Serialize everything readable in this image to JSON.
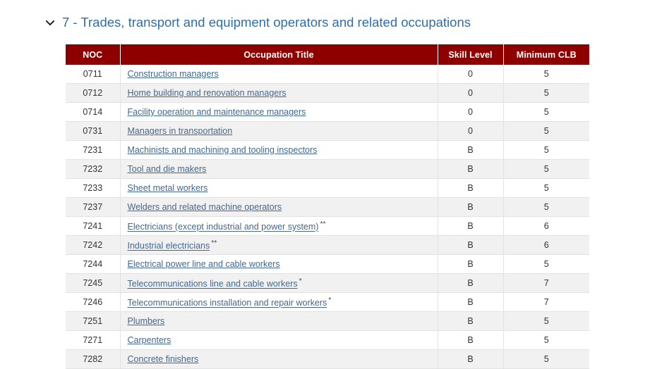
{
  "section": {
    "icon": "chevron-down-icon",
    "expanded": true,
    "title": "7 - Trades, transport and equipment operators and related occupations",
    "title_color": "#2f6ea8"
  },
  "table": {
    "header_bg": "#8e0000",
    "header_text_color": "#ffffff",
    "link_color": "#42688f",
    "row_alt_bg": "#f1f1f1",
    "columns": [
      "NOC",
      "Occupation Title",
      "Skill Level",
      "Minimum CLB"
    ],
    "rows": [
      {
        "noc": "0711",
        "title": "Construction managers",
        "note": "",
        "skill": "0",
        "clb": "5"
      },
      {
        "noc": "0712",
        "title": "Home building and renovation managers",
        "note": "",
        "skill": "0",
        "clb": "5"
      },
      {
        "noc": "0714",
        "title": "Facility operation and maintenance managers",
        "note": "",
        "skill": "0",
        "clb": "5"
      },
      {
        "noc": "0731",
        "title": "Managers in transportation",
        "note": "",
        "skill": "0",
        "clb": "5"
      },
      {
        "noc": "7231",
        "title": "Machinists and machining and tooling inspectors",
        "note": "",
        "skill": "B",
        "clb": "5"
      },
      {
        "noc": "7232",
        "title": "Tool and die makers",
        "note": "",
        "skill": "B",
        "clb": "5"
      },
      {
        "noc": "7233",
        "title": "Sheet metal workers",
        "note": "",
        "skill": "B",
        "clb": "5"
      },
      {
        "noc": "7237",
        "title": "Welders and related machine operators",
        "note": "",
        "skill": "B",
        "clb": "5"
      },
      {
        "noc": "7241",
        "title": "Electricians (except industrial and power system)",
        "note": "**",
        "skill": "B",
        "clb": "6"
      },
      {
        "noc": "7242",
        "title": "Industrial electricians",
        "note": "**",
        "skill": "B",
        "clb": "6"
      },
      {
        "noc": "7244",
        "title": "Electrical power line and cable workers",
        "note": "",
        "skill": "B",
        "clb": "5"
      },
      {
        "noc": "7245",
        "title": "Telecommunications line and cable workers",
        "note": "*",
        "skill": "B",
        "clb": "7"
      },
      {
        "noc": "7246",
        "title": "Telecommunications installation and repair workers",
        "note": "*",
        "skill": "B",
        "clb": "7"
      },
      {
        "noc": "7251",
        "title": "Plumbers",
        "note": "",
        "skill": "B",
        "clb": "5"
      },
      {
        "noc": "7271",
        "title": "Carpenters",
        "note": "",
        "skill": "B",
        "clb": "5"
      },
      {
        "noc": "7282",
        "title": "Concrete finishers",
        "note": "",
        "skill": "B",
        "clb": "5"
      }
    ]
  }
}
